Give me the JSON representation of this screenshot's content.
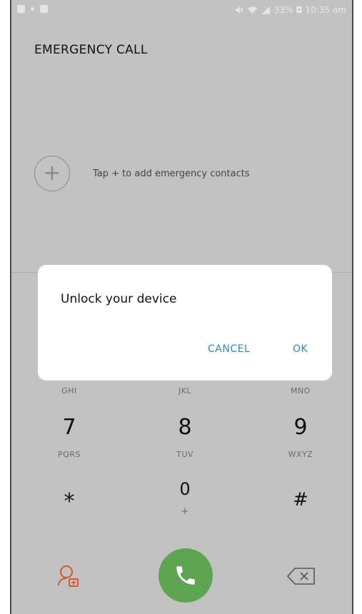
{
  "status": {
    "right_text": "33% ◘ 10:35 am"
  },
  "header": {
    "title": "EMERGENCY CALL"
  },
  "contacts": {
    "add_symbol": "+",
    "hint": "Tap + to add emergency contacts"
  },
  "dialog": {
    "message": "Unlock your device",
    "cancel_label": "CANCEL",
    "ok_label": "OK"
  },
  "dialpad": {
    "row4_letters": [
      "GHI",
      "JKL",
      "MNO"
    ],
    "row5": [
      {
        "digit": "7",
        "letters": "PQRS"
      },
      {
        "digit": "8",
        "letters": "TUV"
      },
      {
        "digit": "9",
        "letters": "WXYZ"
      }
    ],
    "row6": [
      {
        "digit": "*",
        "letters": ""
      },
      {
        "digit": "0",
        "letters": "+"
      },
      {
        "digit": "#",
        "letters": ""
      }
    ]
  },
  "colors": {
    "accent": "#2a8fb5",
    "call": "#5ea552",
    "medical": "#d9542f"
  },
  "icons": {
    "medical_info": "medical-info-icon",
    "call": "phone-icon",
    "backspace": "backspace-icon"
  }
}
